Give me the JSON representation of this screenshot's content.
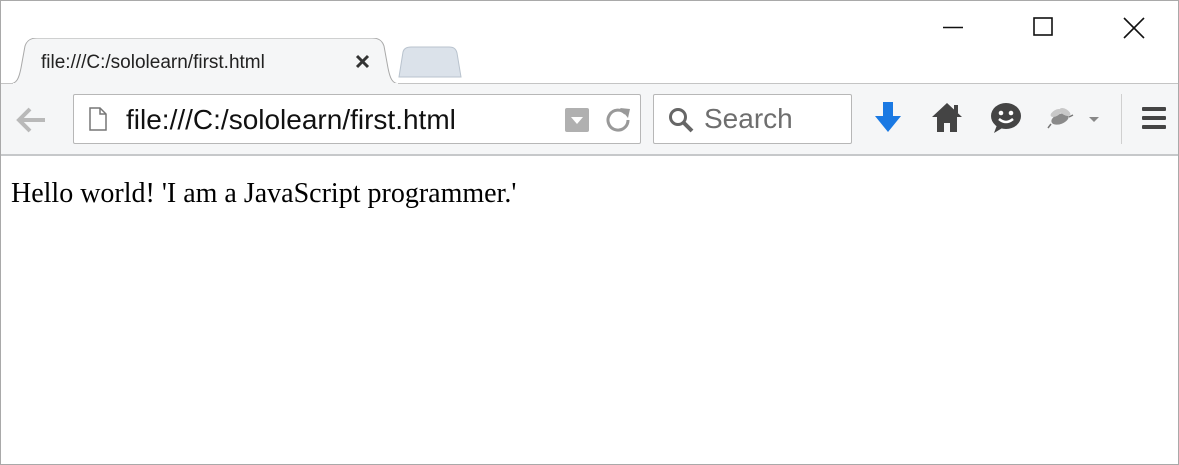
{
  "window": {
    "controls": [
      "minimize-icon",
      "maximize-icon",
      "close-icon"
    ]
  },
  "tab": {
    "title": "file:///C:/sololearn/first.html",
    "close_icon": "close-x-icon"
  },
  "toolbar": {
    "url": "file:///C:/sololearn/first.html",
    "search_placeholder": "Search",
    "icons": [
      "back-arrow-icon",
      "page-icon",
      "dropmarker-icon",
      "reload-icon",
      "search-icon",
      "download-icon",
      "home-icon",
      "chat-icon",
      "bug-icon",
      "menu-icon"
    ],
    "colors": {
      "download": "#1a79e3",
      "icon_dark": "#444444"
    }
  },
  "page": {
    "text": "Hello world! 'I am a JavaScript programmer.'"
  }
}
